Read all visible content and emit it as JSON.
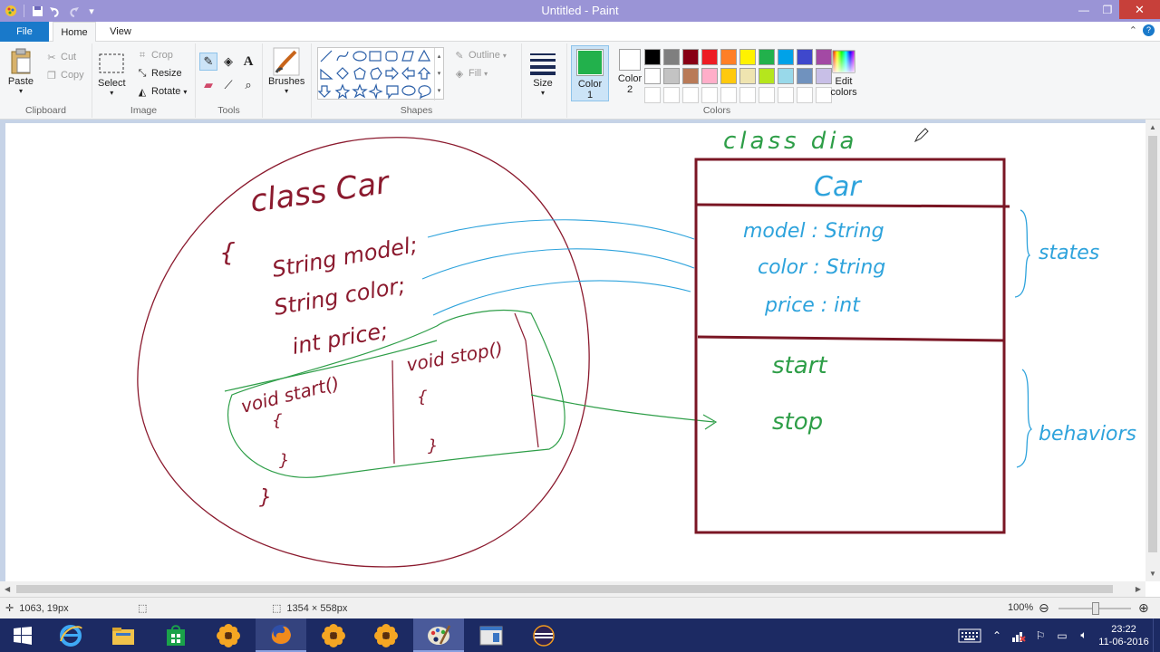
{
  "window": {
    "title": "Untitled - Paint",
    "controls": {
      "minimize": "—",
      "restore": "❐",
      "close": "✕"
    }
  },
  "tabs": {
    "file": "File",
    "home": "Home",
    "view": "View"
  },
  "ribbon": {
    "clipboard": {
      "label": "Clipboard",
      "paste": "Paste",
      "cut": "Cut",
      "copy": "Copy"
    },
    "image": {
      "label": "Image",
      "select": "Select",
      "crop": "Crop",
      "resize": "Resize",
      "rotate": "Rotate"
    },
    "tools": {
      "label": "Tools"
    },
    "brushes": {
      "label": "Brushes"
    },
    "shapes": {
      "label": "Shapes",
      "outline": "Outline",
      "fill": "Fill"
    },
    "size": {
      "label": "Size"
    },
    "colors": {
      "label": "Colors",
      "color1_line1": "Color",
      "color1_line2": "1",
      "color2_line1": "Color",
      "color2_line2": "2",
      "edit_line1": "Edit",
      "edit_line2": "colors",
      "color1_value": "#22b14c",
      "color2_value": "#ffffff",
      "palette_row1": [
        "#000000",
        "#7f7f7f",
        "#880015",
        "#ed1c24",
        "#ff7f27",
        "#fff200",
        "#22b14c",
        "#00a2e8",
        "#3f48cc",
        "#a349a4"
      ],
      "palette_row2": [
        "#ffffff",
        "#c3c3c3",
        "#b97a57",
        "#ffaec9",
        "#ffc90e",
        "#efe4b0",
        "#b5e61d",
        "#99d9ea",
        "#7092be",
        "#c8bfe7"
      ],
      "palette_row3": [
        "#ffffff",
        "#ffffff",
        "#ffffff",
        "#ffffff",
        "#ffffff",
        "#ffffff",
        "#ffffff",
        "#ffffff",
        "#ffffff",
        "#ffffff"
      ]
    }
  },
  "drawing": {
    "colors": {
      "maroon": "#8b1a2e",
      "blue": "#2ea3dc",
      "green": "#2e9e48"
    },
    "left": {
      "class_title": "class Car",
      "open_brace": "{",
      "field1": "String model;",
      "field2": "String color;",
      "field3": "int price;",
      "method1": "void start()",
      "method1_open": "{",
      "method1_close": "}",
      "method2": "void stop()",
      "method2_open": "{",
      "method2_close": "}",
      "class_close": "}"
    },
    "right": {
      "heading": "class dia",
      "class_name": "Car",
      "attr1": "model : String",
      "attr2": "color : String",
      "attr3": "price : int",
      "op1": "start",
      "op2": "stop",
      "label_states": "states",
      "label_behaviors": "behaviors"
    }
  },
  "status": {
    "cursor_pos": "1063, 19px",
    "canvas_size": "1354 × 558px",
    "zoom": "100%"
  },
  "taskbar": {
    "time": "23:22",
    "date": "11-06-2016"
  }
}
